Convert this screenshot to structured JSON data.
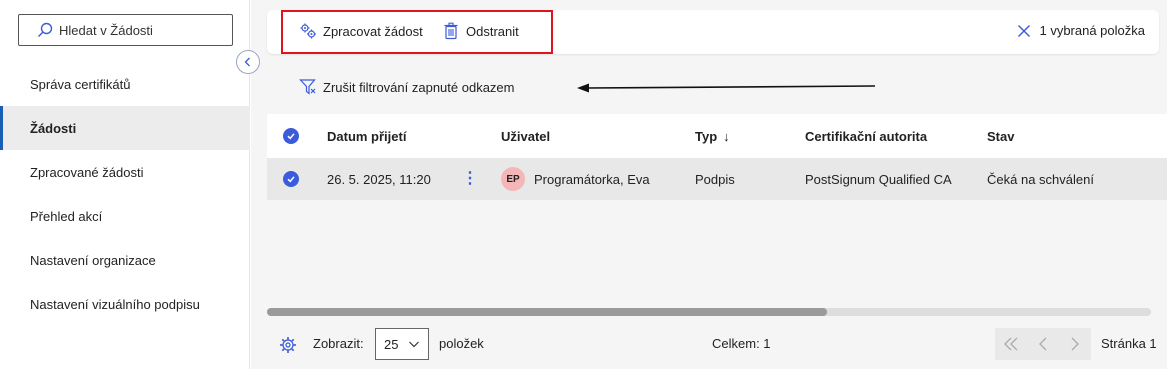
{
  "sidebar": {
    "search_placeholder": "Hledat v Žádosti",
    "items": [
      {
        "label": "Správa certifikátů"
      },
      {
        "label": "Žádosti"
      },
      {
        "label": "Zpracované žádosti"
      },
      {
        "label": "Přehled akcí"
      },
      {
        "label": "Nastavení organizace"
      },
      {
        "label": "Nastavení vizuálního podpisu"
      }
    ],
    "active_index": 1
  },
  "toolbar": {
    "process_label": "Zpracovat žádost",
    "delete_label": "Odstranit",
    "selection_label": "1 vybraná položka"
  },
  "filter": {
    "cancel_label": "Zrušit filtrování zapnuté odkazem"
  },
  "table": {
    "columns": [
      "Datum přijetí",
      "Uživatel",
      "Typ",
      "Certifikační autorita",
      "Stav"
    ],
    "sort_indicator": "↓",
    "rows": [
      {
        "date": "26. 5. 2025, 11:20",
        "user_initials": "EP",
        "user": "Programátorka, Eva",
        "type": "Podpis",
        "authority": "PostSignum Qualified CA",
        "status": "Čeká na schválení"
      }
    ]
  },
  "footer": {
    "show_label": "Zobrazit:",
    "page_size": "25",
    "items_label": "položek",
    "total_label": "Celkem: 1",
    "page_label": "Stránka 1"
  },
  "colors": {
    "accent": "#3b5bdb",
    "highlight_border": "#e0141e",
    "active_nav_bar": "#1a5fb4",
    "avatar_bg": "#f4b6b6"
  }
}
